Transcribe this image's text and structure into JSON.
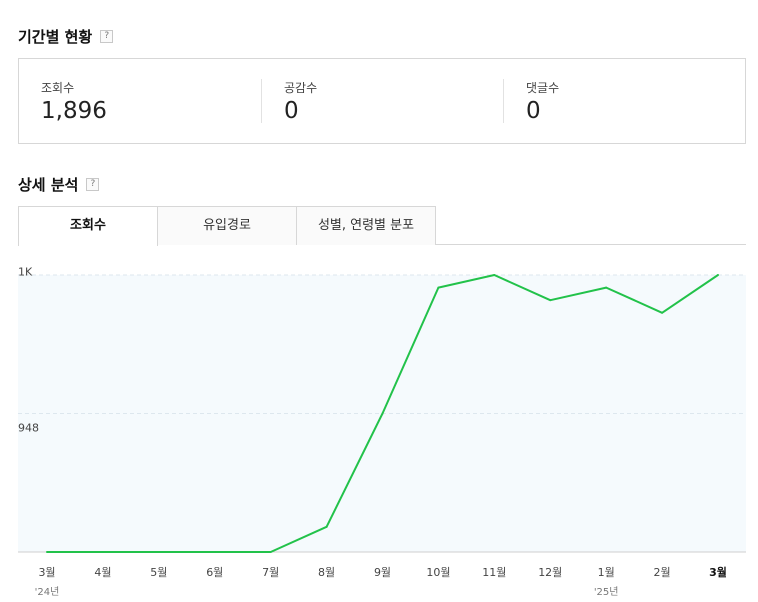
{
  "period_section": {
    "title": "기간별 현황",
    "help": "?",
    "stats": [
      {
        "label": "조회수",
        "value": "1,896"
      },
      {
        "label": "공감수",
        "value": "0"
      },
      {
        "label": "댓글수",
        "value": "0"
      }
    ]
  },
  "detail_section": {
    "title": "상세 분석",
    "help": "?",
    "tabs": [
      {
        "label": "조회수",
        "active": true
      },
      {
        "label": "유입경로",
        "active": false
      },
      {
        "label": "성별, 연령별 분포",
        "active": false
      }
    ]
  },
  "colors": {
    "line": "#22c24a",
    "plot_background": "#f5fafd",
    "grid": "#dde7ee"
  },
  "chart_data": {
    "type": "line",
    "categories": [
      "3월",
      "4월",
      "5월",
      "6월",
      "7월",
      "8월",
      "9월",
      "10월",
      "11월",
      "12월",
      "1월",
      "2월",
      "3월"
    ],
    "year_labels": [
      {
        "index": 0,
        "label": "'24년"
      },
      {
        "index": 10,
        "label": "'25년"
      }
    ],
    "highlight_index": 12,
    "values": [
      948,
      948,
      948,
      948,
      948,
      950,
      959,
      969,
      970,
      968,
      969,
      967,
      970
    ],
    "y_ticks": [
      {
        "value": 948,
        "label": "948"
      },
      {
        "value": 969,
        "label": "1K"
      }
    ],
    "ylim": [
      948,
      970
    ],
    "grid": true
  }
}
